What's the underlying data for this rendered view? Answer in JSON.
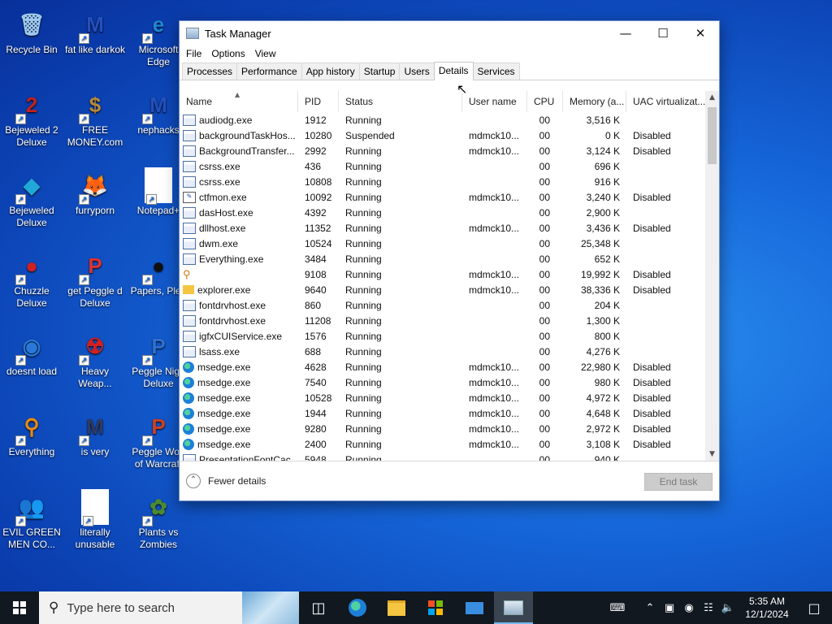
{
  "desktop": {
    "icons": [
      {
        "label": "Recycle Bin",
        "glyph": "🗑",
        "icon": "recycle-bin-icon",
        "color": "#9ec9f0"
      },
      {
        "label": "fat like darkok",
        "glyph": "M",
        "icon": "mpi-logo-icon",
        "color": "#2450c0"
      },
      {
        "label": "Microsoft Edge",
        "glyph": "e",
        "icon": "edge-icon",
        "color": "#1e88d8"
      },
      {
        "label": "Bejeweled 2 Deluxe",
        "glyph": "2",
        "icon": "bejeweled2-icon",
        "color": "#c02020"
      },
      {
        "label": "FREE MONEY.com",
        "glyph": "$",
        "icon": "money-bag-icon",
        "color": "#b88a3a"
      },
      {
        "label": "nephacks",
        "glyph": "M",
        "icon": "mpi-logo-icon",
        "color": "#2450c0"
      },
      {
        "label": "Bejeweled Deluxe",
        "glyph": "◆",
        "icon": "gem-icon",
        "color": "#20a8d8"
      },
      {
        "label": "furryporn",
        "glyph": "🦊",
        "icon": "firefox-icon",
        "color": "#e8601c"
      },
      {
        "label": "Notepad+",
        "glyph": "",
        "icon": "blank-file-icon",
        "color": "#ffffff"
      },
      {
        "label": "Chuzzle Deluxe",
        "glyph": "●",
        "icon": "chuzzle-icon",
        "color": "#d02020"
      },
      {
        "label": "get Peggle d Deluxe",
        "glyph": "P",
        "icon": "peggle-icon",
        "color": "#e03030"
      },
      {
        "label": "Papers, Plea",
        "glyph": "●",
        "icon": "papers-please-icon",
        "color": "#101010"
      },
      {
        "label": "doesnt load",
        "glyph": "◉",
        "icon": "thunderbird-icon",
        "color": "#2a78d8"
      },
      {
        "label": "Heavy Weap...",
        "glyph": "☢",
        "icon": "radiation-icon",
        "color": "#d02020"
      },
      {
        "label": "Peggle Nigh Deluxe",
        "glyph": "P",
        "icon": "peggle-nights-icon",
        "color": "#3070d0"
      },
      {
        "label": "Everything",
        "glyph": "⚲",
        "icon": "everything-search-icon",
        "color": "#e88a10"
      },
      {
        "label": "is very",
        "glyph": "M",
        "icon": "mpi-shield-icon",
        "color": "#303a60"
      },
      {
        "label": "Peggle Worl of Warcraft",
        "glyph": "P",
        "icon": "peggle-wow-icon",
        "color": "#d04020"
      },
      {
        "label": "EVIL GREEN MEN CO...",
        "glyph": "👥",
        "icon": "green-men-icon",
        "color": "#30b040"
      },
      {
        "label": "literally unusable",
        "glyph": "",
        "icon": "blank-file-icon",
        "color": "#ffffff"
      },
      {
        "label": "Plants vs Zombies",
        "glyph": "✿",
        "icon": "plants-vs-zombies-icon",
        "color": "#4a8a30"
      }
    ]
  },
  "window": {
    "title": "Task Manager",
    "menu": [
      "File",
      "Options",
      "View"
    ],
    "tabs": [
      "Processes",
      "Performance",
      "App history",
      "Startup",
      "Users",
      "Details",
      "Services"
    ],
    "active_tab": "Details",
    "columns": [
      "Name",
      "PID",
      "Status",
      "User name",
      "CPU",
      "Memory (a...",
      "UAC virtualizat..."
    ],
    "rows": [
      {
        "name": "audiodg.exe",
        "pid": "1912",
        "status": "Running",
        "user": "",
        "cpu": "00",
        "mem": "3,516 K",
        "uac": "",
        "icon": "app"
      },
      {
        "name": "backgroundTaskHos...",
        "pid": "10280",
        "status": "Suspended",
        "user": "mdmck10...",
        "cpu": "00",
        "mem": "0 K",
        "uac": "Disabled",
        "icon": "app"
      },
      {
        "name": "BackgroundTransfer...",
        "pid": "2992",
        "status": "Running",
        "user": "mdmck10...",
        "cpu": "00",
        "mem": "3,124 K",
        "uac": "Disabled",
        "icon": "app"
      },
      {
        "name": "csrss.exe",
        "pid": "436",
        "status": "Running",
        "user": "",
        "cpu": "00",
        "mem": "696 K",
        "uac": "",
        "icon": "app"
      },
      {
        "name": "csrss.exe",
        "pid": "10808",
        "status": "Running",
        "user": "",
        "cpu": "00",
        "mem": "916 K",
        "uac": "",
        "icon": "app"
      },
      {
        "name": "ctfmon.exe",
        "pid": "10092",
        "status": "Running",
        "user": "mdmck10...",
        "cpu": "00",
        "mem": "3,240 K",
        "uac": "Disabled",
        "icon": "note"
      },
      {
        "name": "dasHost.exe",
        "pid": "4392",
        "status": "Running",
        "user": "",
        "cpu": "00",
        "mem": "2,900 K",
        "uac": "",
        "icon": "app"
      },
      {
        "name": "dllhost.exe",
        "pid": "11352",
        "status": "Running",
        "user": "mdmck10...",
        "cpu": "00",
        "mem": "3,436 K",
        "uac": "Disabled",
        "icon": "app"
      },
      {
        "name": "dwm.exe",
        "pid": "10524",
        "status": "Running",
        "user": "",
        "cpu": "00",
        "mem": "25,348 K",
        "uac": "",
        "icon": "app"
      },
      {
        "name": "Everything.exe",
        "pid": "3484",
        "status": "Running",
        "user": "",
        "cpu": "00",
        "mem": "652 K",
        "uac": "",
        "icon": "app"
      },
      {
        "name": "Everything.exe",
        "pid": "9108",
        "status": "Running",
        "user": "mdmck10...",
        "cpu": "00",
        "mem": "19,992 K",
        "uac": "Disabled",
        "icon": "search"
      },
      {
        "name": "explorer.exe",
        "pid": "9640",
        "status": "Running",
        "user": "mdmck10...",
        "cpu": "00",
        "mem": "38,336 K",
        "uac": "Disabled",
        "icon": "folder"
      },
      {
        "name": "fontdrvhost.exe",
        "pid": "860",
        "status": "Running",
        "user": "",
        "cpu": "00",
        "mem": "204 K",
        "uac": "",
        "icon": "app"
      },
      {
        "name": "fontdrvhost.exe",
        "pid": "11208",
        "status": "Running",
        "user": "",
        "cpu": "00",
        "mem": "1,300 K",
        "uac": "",
        "icon": "app"
      },
      {
        "name": "igfxCUIService.exe",
        "pid": "1576",
        "status": "Running",
        "user": "",
        "cpu": "00",
        "mem": "800 K",
        "uac": "",
        "icon": "app"
      },
      {
        "name": "lsass.exe",
        "pid": "688",
        "status": "Running",
        "user": "",
        "cpu": "00",
        "mem": "4,276 K",
        "uac": "",
        "icon": "app"
      },
      {
        "name": "msedge.exe",
        "pid": "4628",
        "status": "Running",
        "user": "mdmck10...",
        "cpu": "00",
        "mem": "22,980 K",
        "uac": "Disabled",
        "icon": "edge"
      },
      {
        "name": "msedge.exe",
        "pid": "7540",
        "status": "Running",
        "user": "mdmck10...",
        "cpu": "00",
        "mem": "980 K",
        "uac": "Disabled",
        "icon": "edge"
      },
      {
        "name": "msedge.exe",
        "pid": "10528",
        "status": "Running",
        "user": "mdmck10...",
        "cpu": "00",
        "mem": "4,972 K",
        "uac": "Disabled",
        "icon": "edge"
      },
      {
        "name": "msedge.exe",
        "pid": "1944",
        "status": "Running",
        "user": "mdmck10...",
        "cpu": "00",
        "mem": "4,648 K",
        "uac": "Disabled",
        "icon": "edge"
      },
      {
        "name": "msedge.exe",
        "pid": "9280",
        "status": "Running",
        "user": "mdmck10...",
        "cpu": "00",
        "mem": "2,972 K",
        "uac": "Disabled",
        "icon": "edge"
      },
      {
        "name": "msedge.exe",
        "pid": "2400",
        "status": "Running",
        "user": "mdmck10...",
        "cpu": "00",
        "mem": "3,108 K",
        "uac": "Disabled",
        "icon": "edge"
      },
      {
        "name": "PresentationFontCac...",
        "pid": "5948",
        "status": "Running",
        "user": "",
        "cpu": "00",
        "mem": "940 K",
        "uac": "",
        "icon": "app"
      }
    ],
    "fewer_details": "Fewer details",
    "end_task": "End task"
  },
  "taskbar": {
    "search_placeholder": "Type here to search",
    "time": "5:35 AM",
    "date": "12/1/2024"
  },
  "colors": {
    "accent": "#76b9ed",
    "taskbar_bg": "#111820",
    "desktop_bg": "#1565d8"
  }
}
